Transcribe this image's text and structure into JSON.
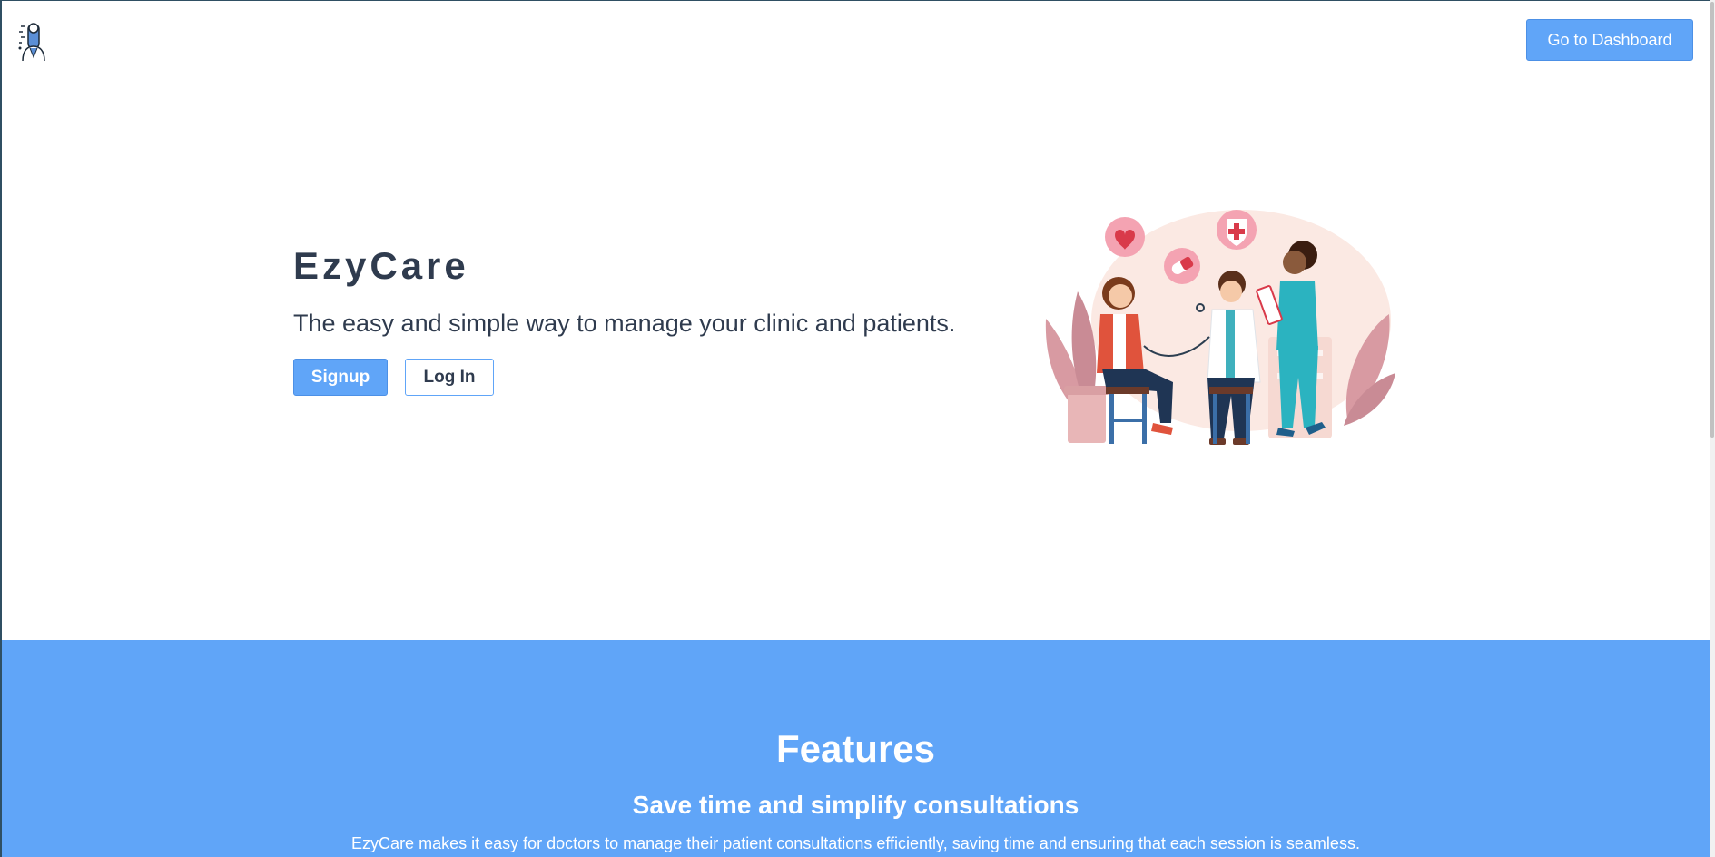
{
  "header": {
    "logo_icon": "doctor-logo-icon",
    "dashboard_label": "Go to Dashboard"
  },
  "hero": {
    "title": "EzyCare",
    "tagline": "The easy and simple way to manage your clinic and patients.",
    "signup_label": "Signup",
    "login_label": "Log In",
    "illustration_icon": "doctor-patient-consultation-illustration"
  },
  "features": {
    "title": "Features",
    "subtitle": "Save time and simplify consultations",
    "description": "EzyCare makes it easy for doctors to manage their patient consultations efficiently, saving time and ensuring that each session is seamless."
  },
  "colors": {
    "accent": "#60a5f8",
    "text": "#2f3b4e",
    "background": "#ffffff"
  }
}
